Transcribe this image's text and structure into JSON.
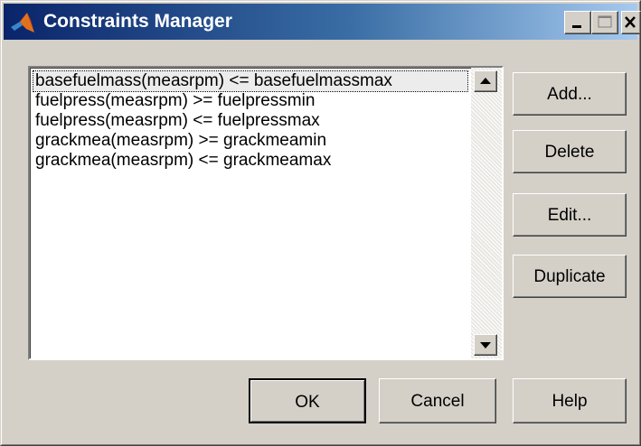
{
  "window": {
    "title": "Constraints Manager",
    "title_icon": "matlab-logo-icon",
    "controls": [
      "minimize-icon",
      "maximize-icon",
      "close-icon"
    ]
  },
  "constraints": {
    "items": [
      "basefuelmass(measrpm) <= basefuelmassmax",
      "fuelpress(measrpm) >= fuelpressmin",
      "fuelpress(measrpm) <= fuelpressmax",
      "grackmea(measrpm) >= grackmeamin",
      "grackmea(measrpm) <= grackmeamax"
    ],
    "selected_index": 0
  },
  "side_buttons": {
    "add": "Add...",
    "delete": "Delete",
    "edit": "Edit...",
    "duplicate": "Duplicate"
  },
  "bottom_buttons": {
    "ok": "OK",
    "cancel": "Cancel",
    "help": "Help"
  },
  "colors": {
    "titlebar_start": "#0a246a",
    "titlebar_end": "#a6caf0",
    "face": "#d4d0c8"
  }
}
